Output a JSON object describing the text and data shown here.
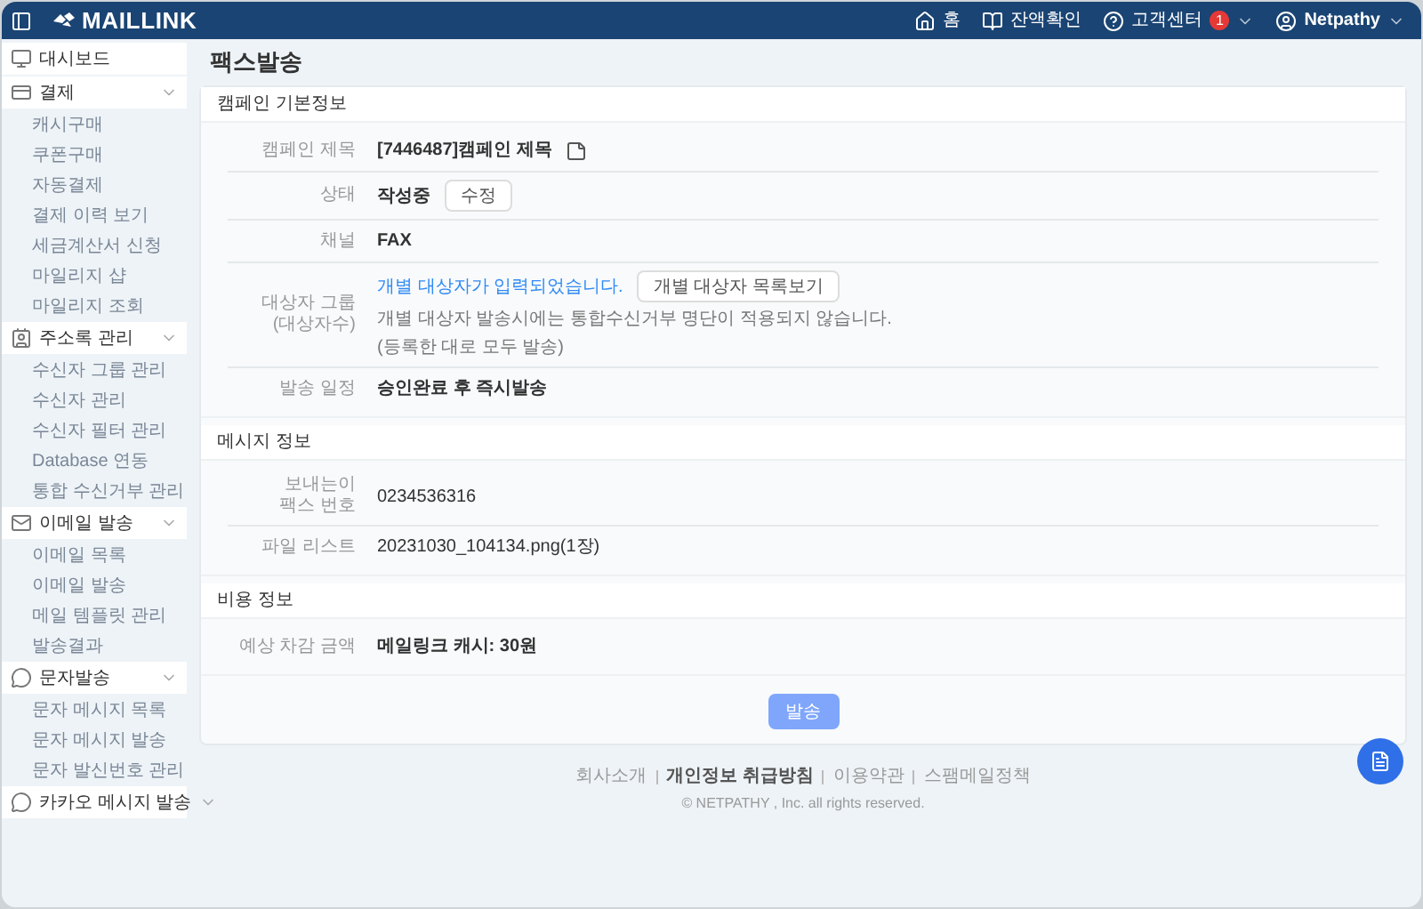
{
  "header": {
    "logo": "MAILLINK",
    "nav": [
      {
        "kind": "home",
        "label": "홈"
      },
      {
        "kind": "balance",
        "label": "잔액확인"
      },
      {
        "kind": "support",
        "label": "고객센터",
        "badge": "1"
      },
      {
        "kind": "user",
        "label": "Netpathy"
      }
    ]
  },
  "sidebar": {
    "items": [
      {
        "kind": "link",
        "label": "대시보드"
      },
      {
        "kind": "group",
        "label": "결제",
        "children": [
          {
            "label": "캐시구매"
          },
          {
            "label": "쿠폰구매"
          },
          {
            "label": "자동결제"
          },
          {
            "label": "결제 이력 보기"
          },
          {
            "label": "세금계산서 신청"
          },
          {
            "label": "마일리지 샵"
          },
          {
            "label": "마일리지 조회"
          }
        ]
      },
      {
        "kind": "group",
        "label": "주소록 관리",
        "children": [
          {
            "label": "수신자 그룹 관리"
          },
          {
            "label": "수신자 관리"
          },
          {
            "label": "수신자 필터 관리"
          },
          {
            "label": "Database 연동"
          },
          {
            "label": "통합 수신거부 관리"
          }
        ]
      },
      {
        "kind": "group",
        "label": "이메일 발송",
        "children": [
          {
            "label": "이메일 목록"
          },
          {
            "label": "이메일 발송"
          },
          {
            "label": "메일 템플릿 관리"
          },
          {
            "label": "발송결과"
          }
        ]
      },
      {
        "kind": "group",
        "label": "문자발송",
        "children": [
          {
            "label": "문자 메시지 목록"
          },
          {
            "label": "문자 메시지 발송"
          },
          {
            "label": "문자 발신번호 관리"
          }
        ]
      },
      {
        "kind": "group",
        "label": "카카오 메시지 발송"
      }
    ]
  },
  "page_title": "팩스발송",
  "sections": [
    {
      "title": "캠페인 기본정보",
      "rows": [
        {
          "kind": "title",
          "label": "캠페인 제목",
          "value": "[7446487]캠페인 제목"
        },
        {
          "kind": "status",
          "label": "상태",
          "value": "작성중",
          "button": "수정"
        },
        {
          "kind": "text",
          "label": "채널",
          "value": "FAX"
        },
        {
          "kind": "group",
          "label": "대상자 그룹\n(대상자수)",
          "link": "개별 대상자가 입력되었습니다.",
          "button": "개별 대상자 목록보기",
          "notes": [
            "개별 대상자 발송시에는 통합수신거부 명단이 적용되지 않습니다.",
            "(등록한 대로 모두 발송)"
          ]
        },
        {
          "kind": "text",
          "label": "발송 일정",
          "value": "승인완료 후 즉시발송"
        }
      ]
    },
    {
      "title": "메시지 정보",
      "rows": [
        {
          "kind": "plain",
          "label": "보내는이\n팩스 번호",
          "value": "0234536316"
        },
        {
          "kind": "plain",
          "label": "파일 리스트",
          "value": "20231030_104134.png(1장)"
        }
      ]
    },
    {
      "title": "비용 정보",
      "rows": [
        {
          "kind": "text",
          "label": "예상 차감 금액",
          "value": "메일링크 캐시: 30원"
        }
      ]
    }
  ],
  "submit": {
    "label": "발송",
    "disabled": true
  },
  "footer": {
    "links": [
      {
        "label": "회사소개",
        "bold": false
      },
      {
        "label": "개인정보 취급방침",
        "bold": true
      },
      {
        "label": "이용약관",
        "bold": false
      },
      {
        "label": "스팸메일정책",
        "bold": false
      }
    ],
    "copyright": "© NETPATHY , Inc. all rights reserved."
  }
}
